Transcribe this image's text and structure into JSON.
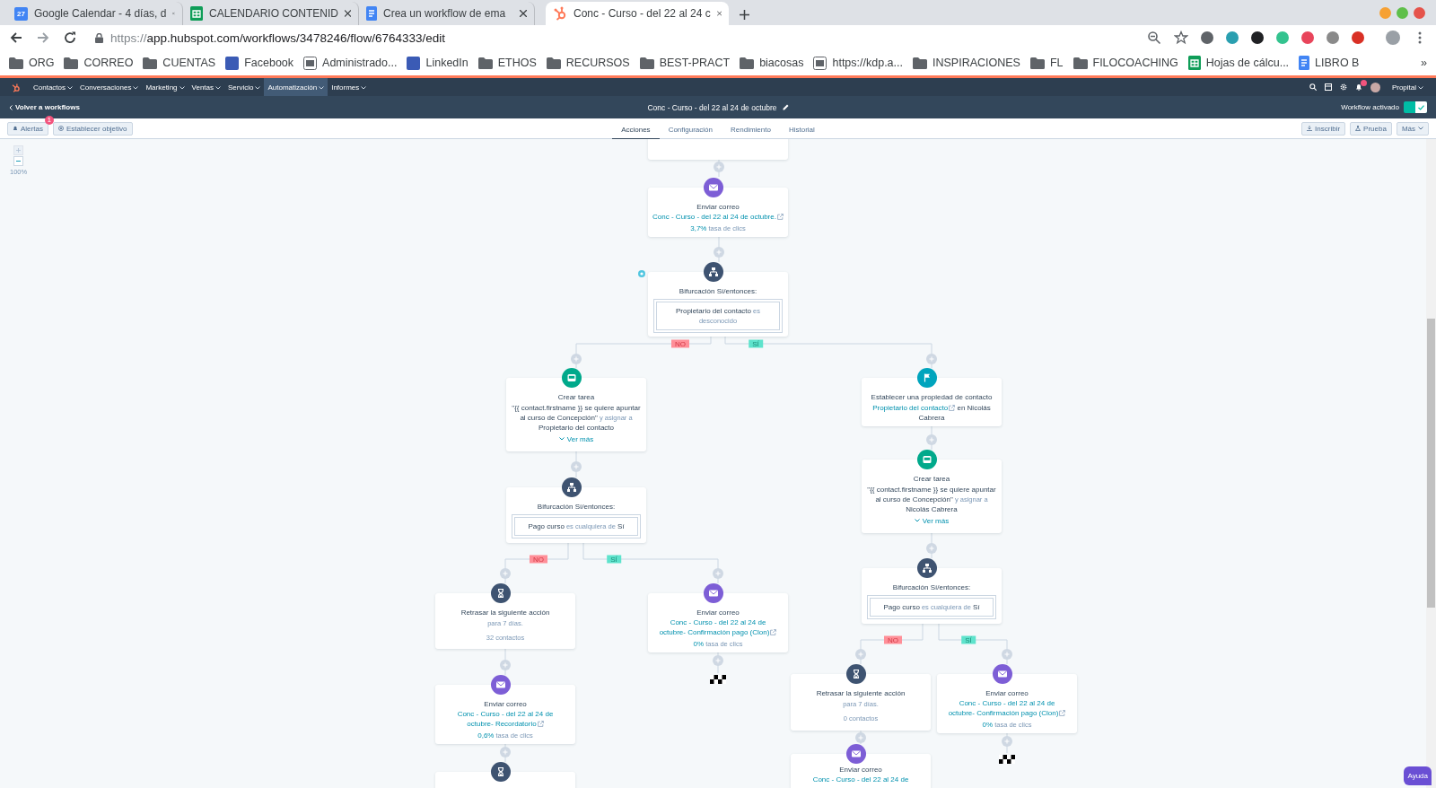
{
  "browser": {
    "tabs": [
      {
        "title": "Google Calendar - 4 días, d",
        "kind": "calendar",
        "badge": "27",
        "selected": false
      },
      {
        "title": "CALENDARIO CONTENID",
        "kind": "sheets",
        "selected": false
      },
      {
        "title": "Crea un workflow de ema",
        "kind": "docs",
        "selected": false
      },
      {
        "title": "Conc - Curso - del 22 al 24 c",
        "kind": "hubspot",
        "selected": true
      }
    ],
    "url_scheme": "https://",
    "url_rest": "app.hubspot.com/workflows/3478246/flow/6764333/edit",
    "bookmarks": [
      {
        "label": "ORG",
        "kind": "folder"
      },
      {
        "label": "CORREO",
        "kind": "folder"
      },
      {
        "label": "CUENTAS",
        "kind": "folder"
      },
      {
        "label": "Facebook",
        "kind": "logo"
      },
      {
        "label": "Administrado...",
        "kind": "page"
      },
      {
        "label": "LinkedIn",
        "kind": "logo"
      },
      {
        "label": "ETHOS",
        "kind": "folder"
      },
      {
        "label": "RECURSOS",
        "kind": "folder"
      },
      {
        "label": "BEST-PRACT",
        "kind": "folder"
      },
      {
        "label": "biacosas",
        "kind": "folder"
      },
      {
        "label": "https://kdp.a...",
        "kind": "page"
      },
      {
        "label": "INSPIRACIONES",
        "kind": "folder"
      },
      {
        "label": "FL",
        "kind": "folder"
      },
      {
        "label": "FILOCOACHING",
        "kind": "folder"
      },
      {
        "label": "Hojas de cálcu...",
        "kind": "sheets"
      },
      {
        "label": "LIBRO B",
        "kind": "docs"
      }
    ],
    "bookmarks_more": "»"
  },
  "hubspot": {
    "nav": [
      {
        "label": "Contactos",
        "selected": false
      },
      {
        "label": "Conversaciones",
        "selected": false
      },
      {
        "label": "Marketing",
        "selected": false
      },
      {
        "label": "Ventas",
        "selected": false
      },
      {
        "label": "Servicio",
        "selected": false
      },
      {
        "label": "Automatización",
        "selected": true
      },
      {
        "label": "Informes",
        "selected": false
      }
    ],
    "account": "Propital"
  },
  "header": {
    "back": "Volver a workflows",
    "title": "Conc - Curso -  del 22 al 24 de octubre",
    "status_label": "Workflow activado",
    "active": true
  },
  "toolbar": {
    "alerts": {
      "label": "Alertas",
      "count": "1"
    },
    "goal": "Establecer objetivo",
    "tabs": [
      {
        "label": "Acciones",
        "selected": true
      },
      {
        "label": "Configuración",
        "selected": false
      },
      {
        "label": "Rendimiento",
        "selected": false
      },
      {
        "label": "Historial",
        "selected": false
      }
    ],
    "actions": [
      {
        "label": "Inscribir",
        "kind": "enroll"
      },
      {
        "label": "Prueba",
        "kind": "test"
      },
      {
        "label": "Más",
        "kind": "menu"
      }
    ]
  },
  "zoom": {
    "level": "100%"
  },
  "flow": {
    "nodes": [
      {
        "kind": "stub"
      },
      {
        "kind": "email",
        "description": [
          {
            "text": "Enviar correo ",
            "kind": "plain"
          },
          {
            "text": "Conc - Curso - del 22 al 24 de ",
            "kind": "link"
          },
          {
            "text": "octubre.",
            "kind": "link",
            "external": true
          }
        ],
        "stat": [
          {
            "text": "3,7%",
            "kind": "accent"
          },
          {
            "text": " tasa de clics",
            "kind": "muted"
          }
        ]
      },
      {
        "kind": "branch",
        "title": "Bifurcación Sí/entonces:",
        "marker": true,
        "condition": [
          {
            "text": "Propietario del contacto",
            "kind": "plain"
          },
          {
            "text": " es desconocido",
            "kind": "muted"
          }
        ]
      },
      {
        "kind": "task",
        "title": "Crear tarea",
        "description": [
          {
            "text": "\"{{ contact.firstname }} se quiere apuntar al curso de Concepción\"",
            "kind": "plain"
          },
          {
            "text": " y asignar a ",
            "kind": "muted"
          },
          {
            "text": "Propietario del contacto",
            "kind": "plain"
          }
        ],
        "more": "Ver más"
      },
      {
        "kind": "branch",
        "title": "Bifurcación Sí/entonces:",
        "marker": false,
        "condition": [
          {
            "text": "Pago curso",
            "kind": "plain"
          },
          {
            "text": " es cualquiera de ",
            "kind": "muted"
          },
          {
            "text": "Sí",
            "kind": "plain"
          }
        ]
      },
      {
        "kind": "delay",
        "title": "Retrasar la siguiente acción",
        "detail": "para 7 días.",
        "count": "32 contactos"
      },
      {
        "kind": "email",
        "description": [
          {
            "text": "Enviar correo ",
            "kind": "plain"
          },
          {
            "text": "Conc - Curso - del 22 al 24 de ",
            "kind": "link"
          },
          {
            "text": "octubre- Confirmación pago (Clon)",
            "kind": "link",
            "external": true
          }
        ],
        "stat": [
          {
            "text": "0%",
            "kind": "accent"
          },
          {
            "text": " tasa de clics",
            "kind": "muted"
          }
        ]
      },
      {
        "kind": "email",
        "description": [
          {
            "text": "Enviar correo ",
            "kind": "plain"
          },
          {
            "text": "Conc - Curso - del 22 al 24 de ",
            "kind": "link"
          },
          {
            "text": "octubre- Recordatorio",
            "kind": "link",
            "external": true
          }
        ],
        "stat": [
          {
            "text": "0,6%",
            "kind": "accent"
          },
          {
            "text": " tasa de clics",
            "kind": "muted"
          }
        ]
      },
      {
        "kind": "delay"
      },
      {
        "kind": "property",
        "title": "Establecer una propiedad de contacto",
        "description": [
          {
            "text": "Propietario del contacto",
            "kind": "link",
            "external": true
          },
          {
            "text": " en Nicolás Cabrera",
            "kind": "plain"
          }
        ]
      },
      {
        "kind": "task",
        "title": "Crear tarea",
        "description": [
          {
            "text": "\"{{ contact.firstname }} se quiere apuntar al curso de Concepción\"",
            "kind": "plain"
          },
          {
            "text": " y asignar a ",
            "kind": "muted"
          },
          {
            "text": "Nicolás Cabrera",
            "kind": "plain"
          }
        ],
        "more": "Ver más"
      },
      {
        "kind": "branch",
        "title": "Bifurcación Sí/entonces:",
        "marker": false,
        "condition": [
          {
            "text": "Pago curso",
            "kind": "plain"
          },
          {
            "text": " es cualquiera de ",
            "kind": "muted"
          },
          {
            "text": "Sí",
            "kind": "plain"
          }
        ]
      },
      {
        "kind": "delay",
        "title": "Retrasar la siguiente acción",
        "detail": "para 7 días.",
        "count": "0 contactos"
      },
      {
        "kind": "email",
        "description": [
          {
            "text": "Enviar correo ",
            "kind": "plain"
          },
          {
            "text": "Conc - Curso - del 22 al 24 de ",
            "kind": "link"
          },
          {
            "text": "octubre- Confirmación pago (Clon)",
            "kind": "link",
            "external": true
          }
        ],
        "stat": [
          {
            "text": "0%",
            "kind": "accent"
          },
          {
            "text": " tasa de clics",
            "kind": "muted"
          }
        ]
      },
      {
        "kind": "email",
        "description": [
          {
            "text": "Enviar correo ",
            "kind": "plain"
          },
          {
            "text": "Conc - Curso - del 22 al 24 de",
            "kind": "link"
          }
        ]
      }
    ],
    "branch_labels": [
      {
        "text": "NO",
        "kind": "no"
      },
      {
        "text": "SÍ",
        "kind": "yes"
      },
      {
        "text": "NO",
        "kind": "no"
      },
      {
        "text": "SÍ",
        "kind": "yes"
      },
      {
        "text": "NO",
        "kind": "no"
      },
      {
        "text": "SÍ",
        "kind": "yes"
      }
    ]
  },
  "help": "Ayuda"
}
